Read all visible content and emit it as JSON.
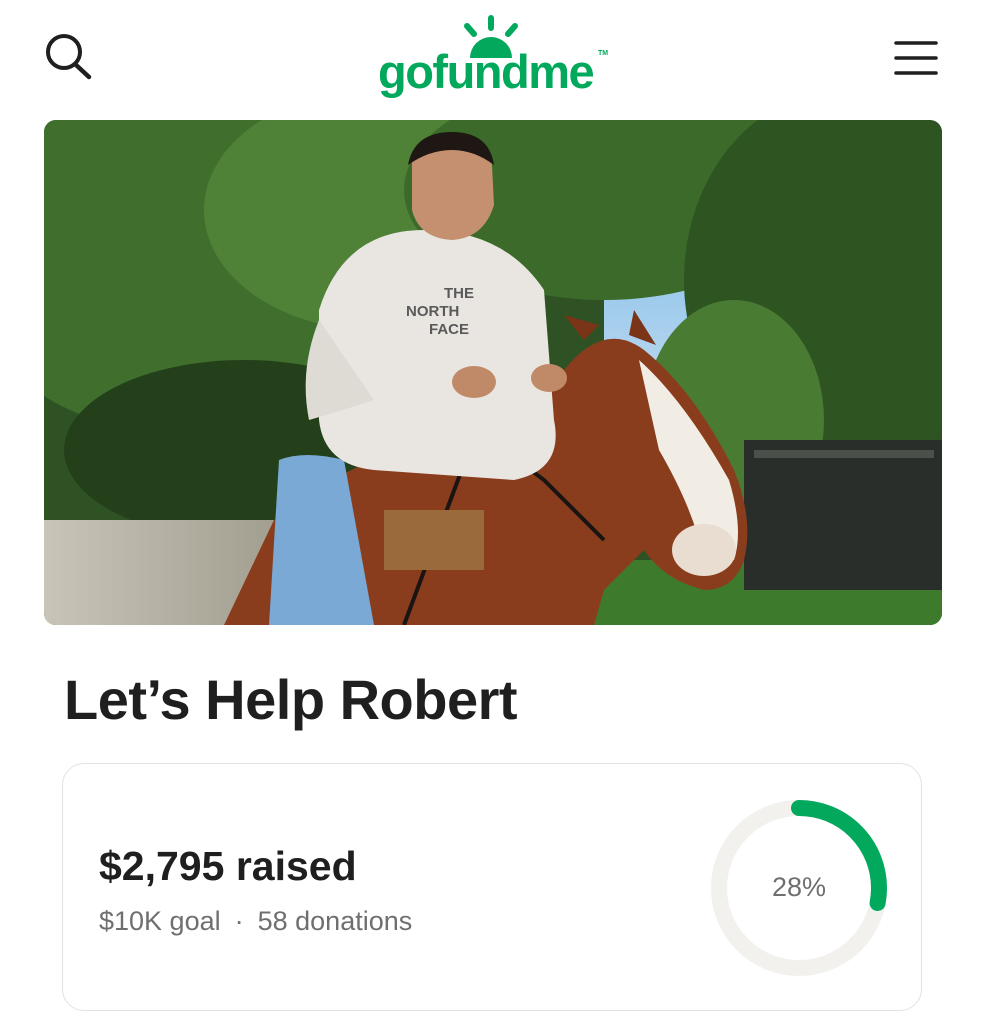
{
  "header": {
    "logo_text": "gofundme",
    "logo_tm": "TM",
    "search_icon": "search-icon",
    "menu_icon": "hamburger-menu-icon"
  },
  "hero": {
    "description_shown": "photo"
  },
  "campaign": {
    "title": "Let’s Help Robert"
  },
  "progress": {
    "amount_raised": "$2,795",
    "raised_label": "raised",
    "goal": "$10K goal",
    "separator": "·",
    "donations": "58 donations",
    "percent_label": "28%",
    "percent_value": 0.28
  },
  "colors": {
    "brand_green": "#02a95c",
    "ring_track": "#f2f1ed",
    "text_dark": "#1f1f1f",
    "text_muted": "#6f6f6f"
  }
}
